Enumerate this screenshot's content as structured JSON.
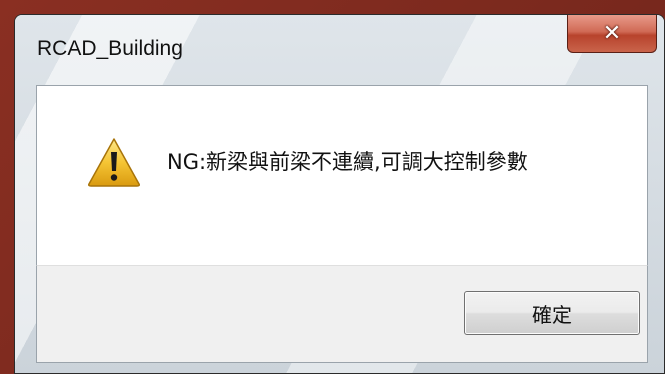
{
  "window": {
    "title": "RCAD_Building",
    "close_glyph": "✕"
  },
  "dialog": {
    "icon": "warning-icon",
    "message": "NG:新梁與前梁不連續,可調大控制參數",
    "ok_label": "確定"
  },
  "colors": {
    "matte": "#7a2a1e",
    "close_button": "#c9644b",
    "warning_yellow": "#f2c230"
  }
}
